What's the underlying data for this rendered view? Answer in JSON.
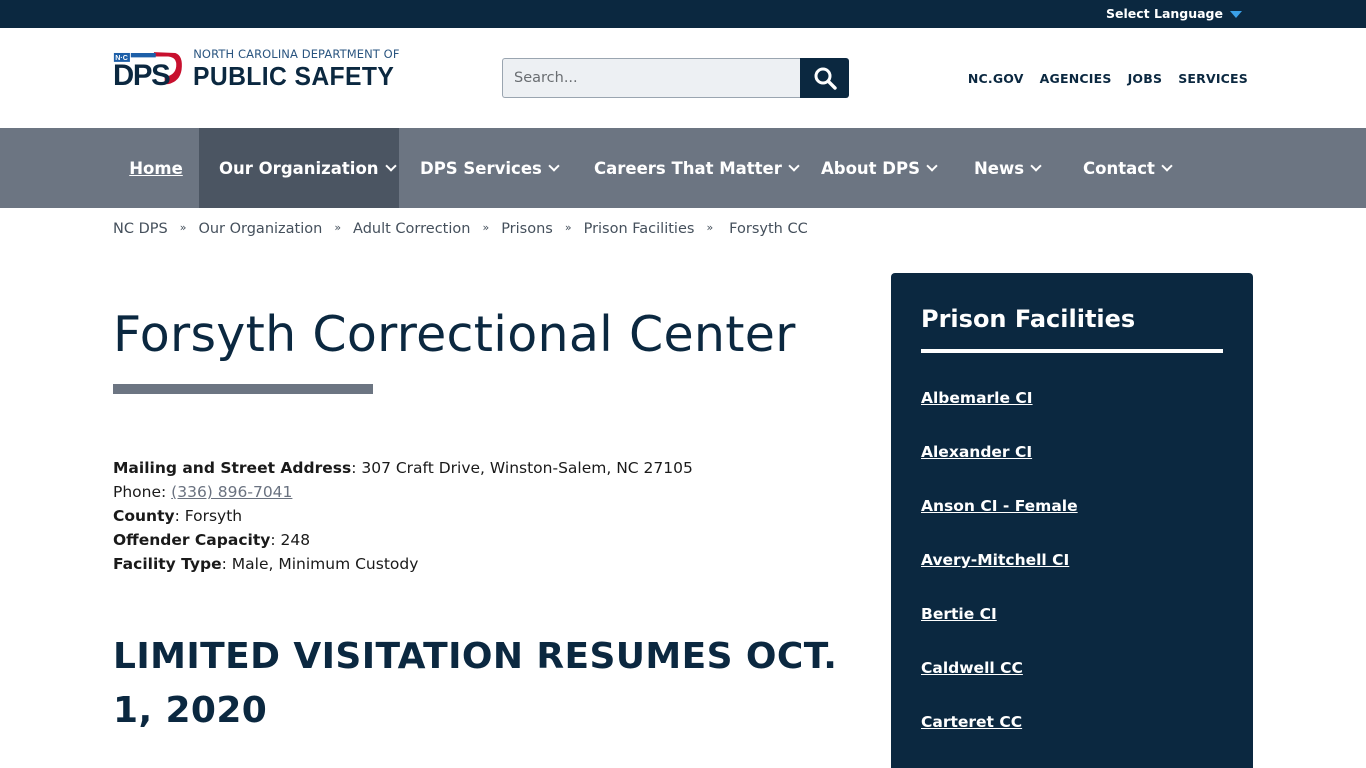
{
  "topbar": {
    "language_label": "Select Language"
  },
  "logo": {
    "mark_text": "DPS",
    "badge_text": "N·C",
    "line1": "NORTH CAROLINA DEPARTMENT OF",
    "line2": "PUBLIC SAFETY"
  },
  "search": {
    "placeholder": "Search..."
  },
  "util_links": [
    "NC.GOV",
    "AGENCIES",
    "JOBS",
    "SERVICES"
  ],
  "nav": [
    {
      "label": "Home"
    },
    {
      "label": "Our Organization"
    },
    {
      "label": "DPS Services"
    },
    {
      "label": "Careers That Matter"
    },
    {
      "label": "About DPS"
    },
    {
      "label": "News"
    },
    {
      "label": "Contact"
    }
  ],
  "breadcrumb": {
    "links": [
      "NC DPS",
      "Our Organization",
      "Adult Correction",
      "Prisons",
      "Prison Facilities"
    ],
    "separator": "»",
    "current": "Forsyth CC"
  },
  "page_title": "Forsyth Correctional Center",
  "info": {
    "address_label": "Mailing and Street Address",
    "address_value": "307 Craft Drive, Winston-Salem, NC 27105",
    "phone_label": "Phone",
    "phone_value": "(336) 896-7041",
    "county_label": "County",
    "county_value": "Forsyth",
    "capacity_label": "Offender Capacity",
    "capacity_value": "248",
    "type_label": "Facility Type",
    "type_value": "Male, Minimum Custody"
  },
  "sub_heading": "LIMITED VISITATION RESUMES OCT. 1, 2020",
  "sidebar": {
    "title": "Prison Facilities",
    "items": [
      "Albemarle CI",
      "Alexander CI",
      "Anson CI - Female",
      "Avery-Mitchell CI",
      "Bertie CI",
      "Caldwell CC",
      "Carteret CC"
    ]
  },
  "colors": {
    "navy": "#0b2840",
    "nav_gray": "#6c7582",
    "nav_active": "#4b5562",
    "accent_red": "#c8102e",
    "accent_blue": "#3aa0e8"
  }
}
